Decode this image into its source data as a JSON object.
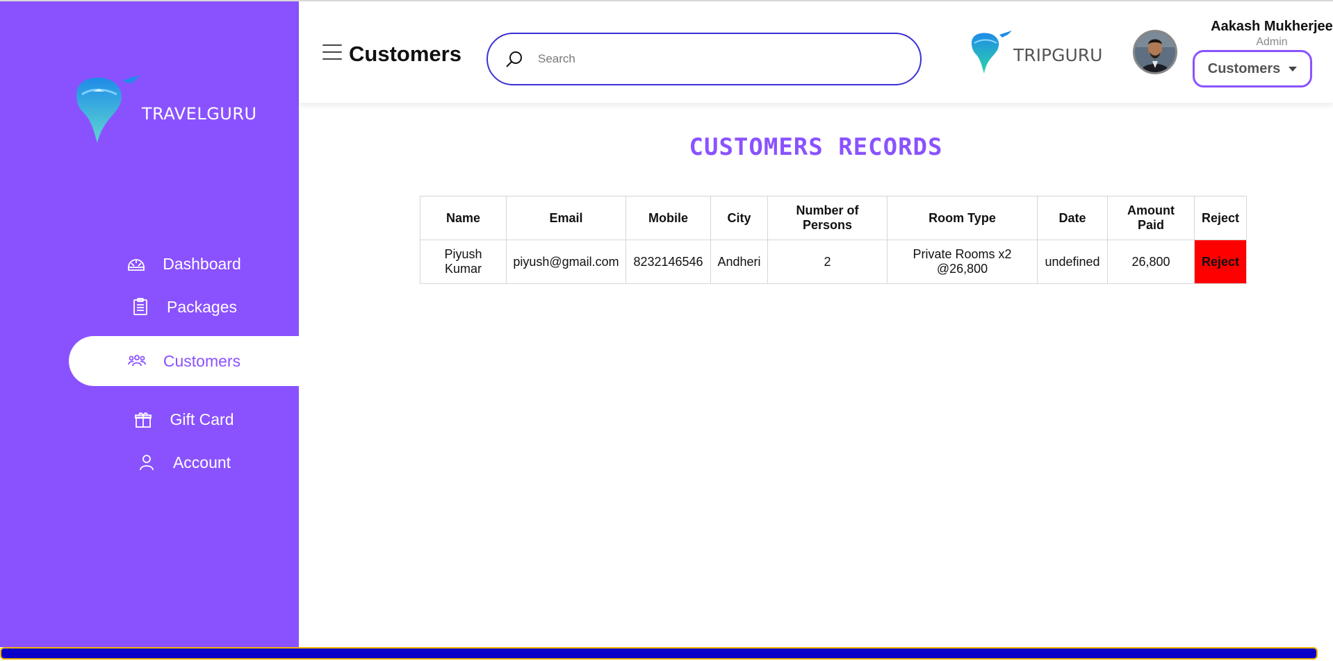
{
  "sidebar": {
    "brand": "TRAVELGURU",
    "items": [
      {
        "label": "Dashboard",
        "icon": "dashboard-icon"
      },
      {
        "label": "Packages",
        "icon": "clipboard-icon"
      },
      {
        "label": "Customers",
        "icon": "users-icon",
        "active": true
      },
      {
        "label": "Gift Card",
        "icon": "gift-icon"
      },
      {
        "label": "Account",
        "icon": "user-icon"
      }
    ]
  },
  "header": {
    "title": "Customers",
    "search_placeholder": "Search",
    "partner_brand": "TRIPGURU",
    "user": {
      "name": "Aakash Mukherjee",
      "role": "Admin"
    },
    "role_dropdown": "Customers"
  },
  "main": {
    "heading": "CUSTOMERS RECORDS",
    "columns": [
      "Name",
      "Email",
      "Mobile",
      "City",
      "Number of Persons",
      "Room Type",
      "Date",
      "Amount Paid",
      "Reject"
    ],
    "rows": [
      {
        "name": "Piyush Kumar",
        "email": "piyush@gmail.com",
        "mobile": "8232146546",
        "city": "Andheri",
        "persons": "2",
        "room_type": "Private Rooms x2 @26,800",
        "date": "undefined",
        "amount": "26,800",
        "action": "Reject"
      }
    ]
  },
  "colors": {
    "sidebar": "#8a52ff",
    "accent": "#8a52ff",
    "search_border": "#3a2fd6",
    "reject": "#ff0000"
  }
}
